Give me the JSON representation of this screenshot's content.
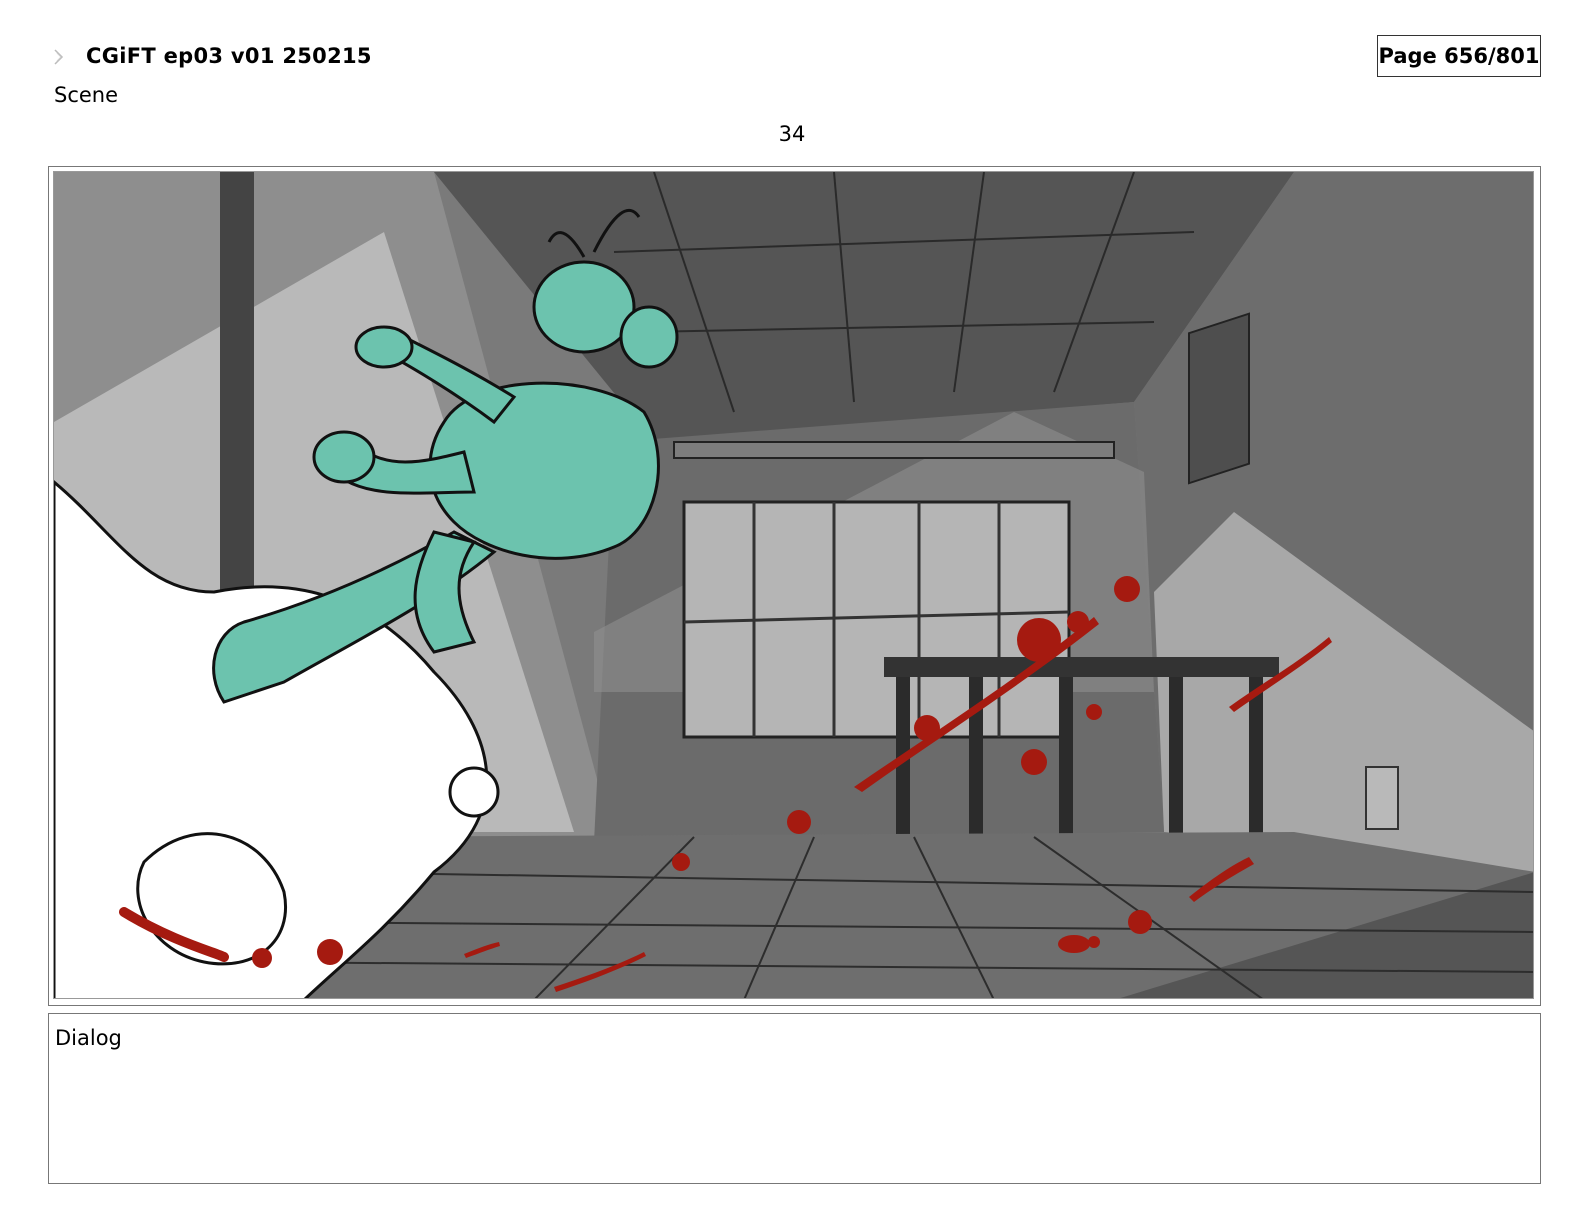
{
  "header": {
    "title": "CGiFT ep03 v01 250215",
    "page_indicator": "Page 656/801",
    "icon": "small-arrow-icon"
  },
  "scene": {
    "label": "Scene",
    "panel_number": "34"
  },
  "panel": {
    "image_icon": "storyboard-drawing",
    "colors": {
      "teal_character": "#6cc3ae",
      "blood_red": "#a51a10",
      "floor_gray": "#6e6e6e",
      "ceiling_gray": "#545454"
    }
  },
  "dialog": {
    "label": "Dialog",
    "text": ""
  }
}
